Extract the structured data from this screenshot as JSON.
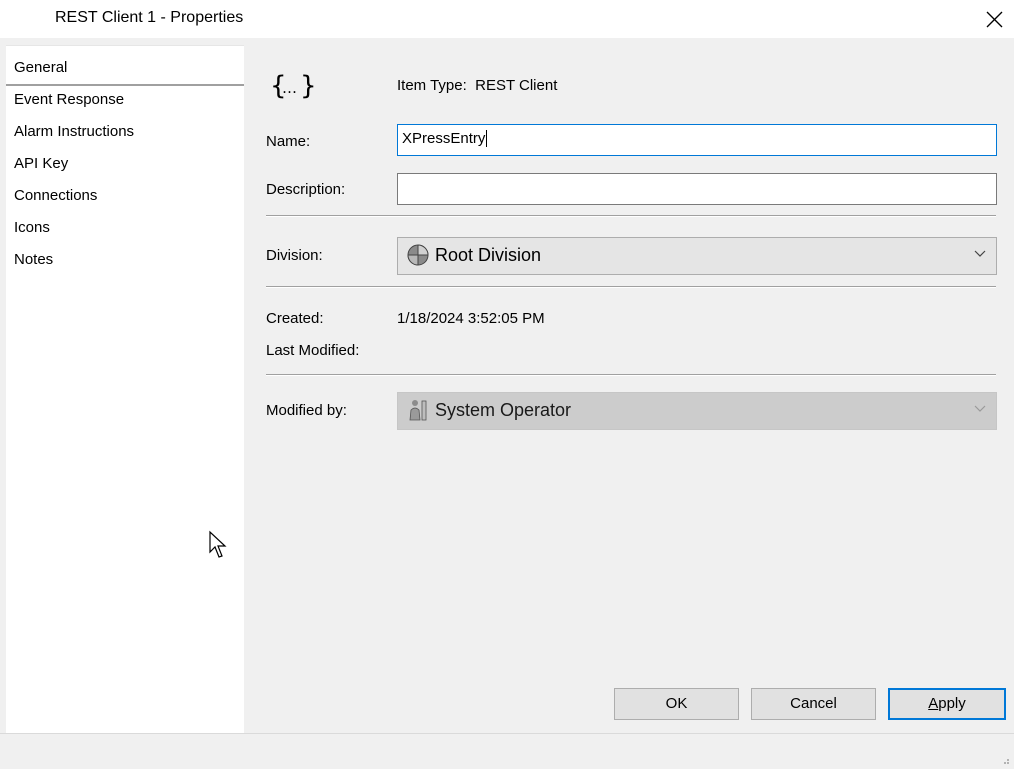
{
  "window": {
    "title": "REST Client 1 - Properties"
  },
  "sidebar": {
    "items": [
      {
        "label": "General",
        "active": true
      },
      {
        "label": "Event Response"
      },
      {
        "label": "Alarm Instructions"
      },
      {
        "label": "API Key"
      },
      {
        "label": "Connections"
      },
      {
        "label": "Icons"
      },
      {
        "label": "Notes"
      }
    ]
  },
  "general": {
    "item_type_label": "Item Type:",
    "item_type_value": "REST Client",
    "name_label": "Name:",
    "name_value": "XPressEntry",
    "description_label": "Description:",
    "description_value": "",
    "division_label": "Division:",
    "division_value": "Root Division",
    "created_label": "Created:",
    "created_value": "1/18/2024 3:52:05 PM",
    "last_modified_label": "Last Modified:",
    "last_modified_value": "",
    "modified_by_label": "Modified by:",
    "modified_by_value": "System Operator"
  },
  "buttons": {
    "ok": "OK",
    "cancel": "Cancel",
    "apply_underlined": "A",
    "apply_rest": "pply"
  },
  "icons": {
    "item_type": "rest-client-braces-icon",
    "division": "division-pie-icon",
    "operator": "operator-person-icon",
    "close": "close-icon"
  },
  "colors": {
    "focus_border": "#0078d7",
    "window_bg": "#f0f0f0"
  }
}
